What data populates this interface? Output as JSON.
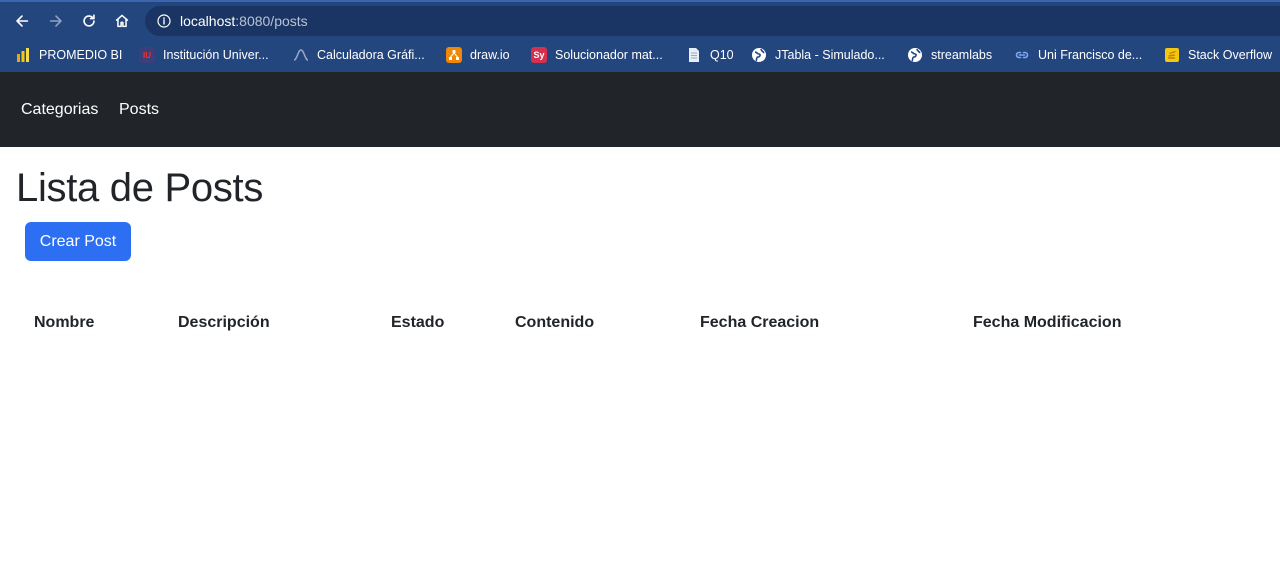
{
  "browser": {
    "url_host": "localhost",
    "url_path": ":8080/posts",
    "bookmarks": [
      {
        "label": "PROMEDIO BI",
        "icon": "powerbi-icon",
        "color": "#f2c811"
      },
      {
        "label": "Institución Univer...",
        "icon": "university-icon",
        "color": "#3b3f7a"
      },
      {
        "label": "Calculadora Gráfi...",
        "icon": "desmos-icon",
        "color": "#23467e"
      },
      {
        "label": "draw.io",
        "icon": "drawio-icon",
        "color": "#f08705"
      },
      {
        "label": "Solucionador mat...",
        "icon": "symbolab-icon",
        "color": "#d6304f"
      },
      {
        "label": "Q10",
        "icon": "document-icon",
        "color": "#e8eef7"
      },
      {
        "label": "JTabla - Simulado...",
        "icon": "globe-icon",
        "color": "#ffffff"
      },
      {
        "label": "streamlabs",
        "icon": "globe-icon",
        "color": "#ffffff"
      },
      {
        "label": "Uni Francisco de...",
        "icon": "link-icon",
        "color": "#7ea7f5"
      },
      {
        "label": "Stack Overflow",
        "icon": "stackoverflow-icon",
        "color": "#f2c811"
      }
    ]
  },
  "navbar": {
    "links": [
      "Categorias",
      "Posts"
    ]
  },
  "main": {
    "title": "Lista de Posts",
    "create_button": "Crear Post",
    "table": {
      "columns": [
        "Nombre",
        "Descripción",
        "Estado",
        "Contenido",
        "Fecha Creacion",
        "Fecha Modificacion"
      ]
    }
  }
}
